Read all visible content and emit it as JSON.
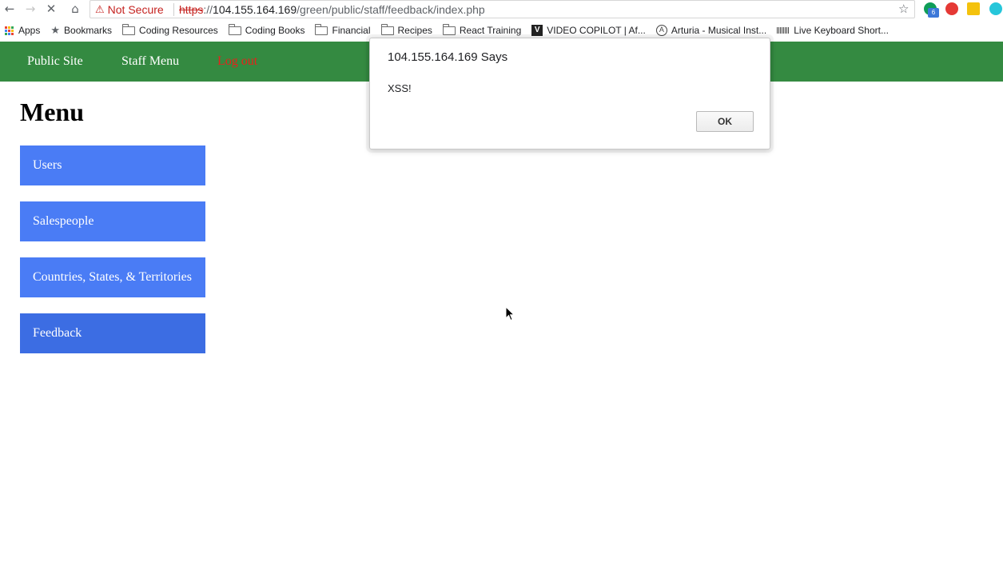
{
  "browser": {
    "security_label": "Not Secure",
    "url_scheme": "https",
    "url_separator": "://",
    "url_host": "104.155.164.169",
    "url_path": "/green/public/staff/feedback/index.php",
    "extension_badge": "6"
  },
  "bookmarks": [
    {
      "label": "Apps",
      "icon": "apps-grid-icon"
    },
    {
      "label": "Bookmarks",
      "icon": "star-icon"
    },
    {
      "label": "Coding Resources",
      "icon": "folder-icon"
    },
    {
      "label": "Coding Books",
      "icon": "folder-icon"
    },
    {
      "label": "Financial",
      "icon": "folder-icon"
    },
    {
      "label": "Recipes",
      "icon": "folder-icon"
    },
    {
      "label": "React Training",
      "icon": "folder-icon"
    },
    {
      "label": "VIDEO COPILOT | Af...",
      "icon": "video-copilot-icon"
    },
    {
      "label": "Arturia - Musical Inst...",
      "icon": "arturia-icon"
    },
    {
      "label": "Live Keyboard Short...",
      "icon": "barcode-icon"
    }
  ],
  "site_nav": {
    "public_site": "Public Site",
    "staff_menu": "Staff Menu",
    "log_out": "Log out"
  },
  "page": {
    "title": "Menu",
    "menu_items": [
      "Users",
      "Salespeople",
      "Countries, States, & Territories",
      "Feedback"
    ]
  },
  "dialog": {
    "title": "104.155.164.169 Says",
    "message": "XSS!",
    "ok_label": "OK"
  },
  "colors": {
    "nav_green": "#348a41",
    "menu_blue": "#4a7cf5",
    "logout_red": "#e8211a",
    "not_secure_red": "#c5221f"
  }
}
